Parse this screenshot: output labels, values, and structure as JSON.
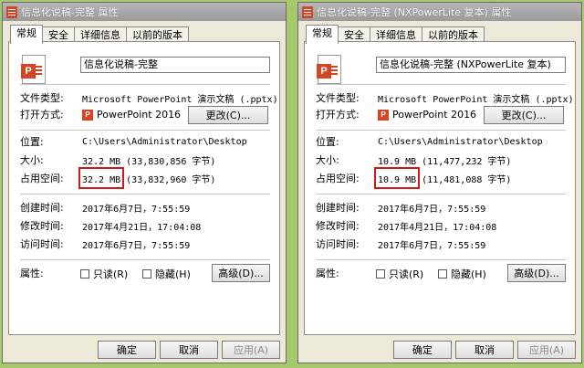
{
  "tabs": [
    "常规",
    "安全",
    "详细信息",
    "以前的版本"
  ],
  "labels": {
    "file_type": "文件类型:",
    "open_with": "打开方式:",
    "location": "位置:",
    "size": "大小:",
    "size_on_disk": "占用空间:",
    "created": "创建时间:",
    "modified": "修改时间:",
    "accessed": "访问时间:",
    "attributes": "属性:"
  },
  "buttons": {
    "change": "更改(C)...",
    "advanced": "高级(D)...",
    "ok": "确定",
    "cancel": "取消",
    "apply": "应用(A)"
  },
  "checkboxes": {
    "readonly": "只读(R)",
    "hidden": "隐藏(H)"
  },
  "windows": [
    {
      "title": "信息化说稿-完整 属性",
      "filename": "信息化说稿-完整",
      "file_type": "Microsoft PowerPoint 演示文稿 (.pptx)",
      "open_with": "PowerPoint 2016",
      "location": "C:\\Users\\Administrator\\Desktop",
      "size": "32.2 MB (33,830,856 字节)",
      "size_on_disk": "32.2 MB (33,832,960 字节)",
      "created": "2017年6月7日，7:55:59",
      "modified": "2017年4月21日，17:04:08",
      "accessed": "2017年6月7日，7:55:59"
    },
    {
      "title": "信息化说稿-完整 (NXPowerLite 复本) 属性",
      "filename": "信息化说稿-完整 (NXPowerLite 复本)",
      "file_type": "Microsoft PowerPoint 演示文稿 (.pptx)",
      "open_with": "PowerPoint 2016",
      "location": "C:\\Users\\Administrator\\Desktop",
      "size": "10.9 MB (11,477,232 字节)",
      "size_on_disk": "10.9 MB (11,481,088 字节)",
      "created": "2017年6月7日，7:55:59",
      "modified": "2017年4月21日，17:04:08",
      "accessed": "2017年6月7日，7:55:59"
    }
  ],
  "colors": {
    "background": "#a7c86c",
    "highlight": "#d01818",
    "ppt_brand": "#d24726"
  }
}
